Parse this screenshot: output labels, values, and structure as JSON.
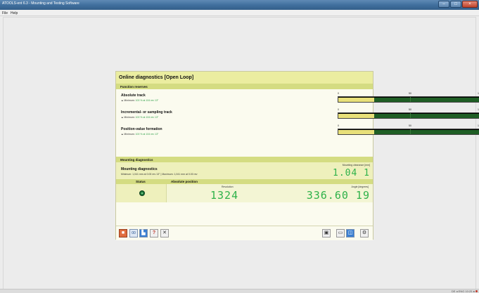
{
  "window": {
    "title": "ATOOLS-ent 6.3 - Mounting and Testing Software",
    "controls": [
      "–",
      "□",
      "×"
    ]
  },
  "menu": {
    "items": [
      "File",
      "Help"
    ]
  },
  "panel": {
    "title": "Online diagnostics [Open Loop]",
    "function_reserves": {
      "heading": "Function reserves",
      "scale_ticks": [
        "0",
        "50",
        "100"
      ],
      "gauges": [
        {
          "label": "Absolute track",
          "sub_prefix": "▲ Minimum:",
          "sub_value": "100 % at 104 rev 13°",
          "fill_start_pct": 25,
          "fill_end_pct": 100
        },
        {
          "label": "Incremental- or sampling track",
          "sub_prefix": "▲ Minimum:",
          "sub_value": "100 % at 104 rev 13°",
          "fill_start_pct": 25,
          "fill_end_pct": 100
        },
        {
          "label": "Position-value formation",
          "sub_prefix": "▲ Minimum:",
          "sub_value": "100 % at 104 rev 13°",
          "fill_start_pct": 25,
          "fill_end_pct": 100
        }
      ]
    },
    "mounting": {
      "heading": "Mounting diagnostics",
      "label": "Mounting diagnostics",
      "sub": "Minimum: 1,041 mm at 0.00 rev 13° | Maximum: 1,041 mm at 0.00 rev",
      "readout_label": "Mounting clearance [mm]",
      "readout_value": "1.04 1"
    },
    "status_row": {
      "status_header": "Status",
      "position_header": "Absolute position",
      "revolution_label": "Revolution",
      "revolution_value": "1324",
      "angle_label": "Angle [degrees]",
      "angle_value": "336.60 19"
    }
  },
  "toolbar": {
    "left": [
      {
        "icon": "stop-icon",
        "glyph": "■"
      },
      {
        "icon": "record-icon",
        "glyph": "00"
      },
      {
        "icon": "chart-icon",
        "glyph": "▙"
      },
      {
        "icon": "help-icon",
        "glyph": "?"
      },
      {
        "icon": "tools-icon",
        "glyph": "✕"
      }
    ],
    "right": [
      {
        "icon": "save-icon",
        "glyph": "▣"
      },
      {
        "icon": "window-icon",
        "glyph": "▭"
      },
      {
        "icon": "layout-icon",
        "glyph": "◫"
      },
      {
        "icon": "settings-icon",
        "glyph": "⚙"
      }
    ]
  },
  "status_bar": {
    "text": "DE  ◂  ENG  10:25  ●"
  }
}
